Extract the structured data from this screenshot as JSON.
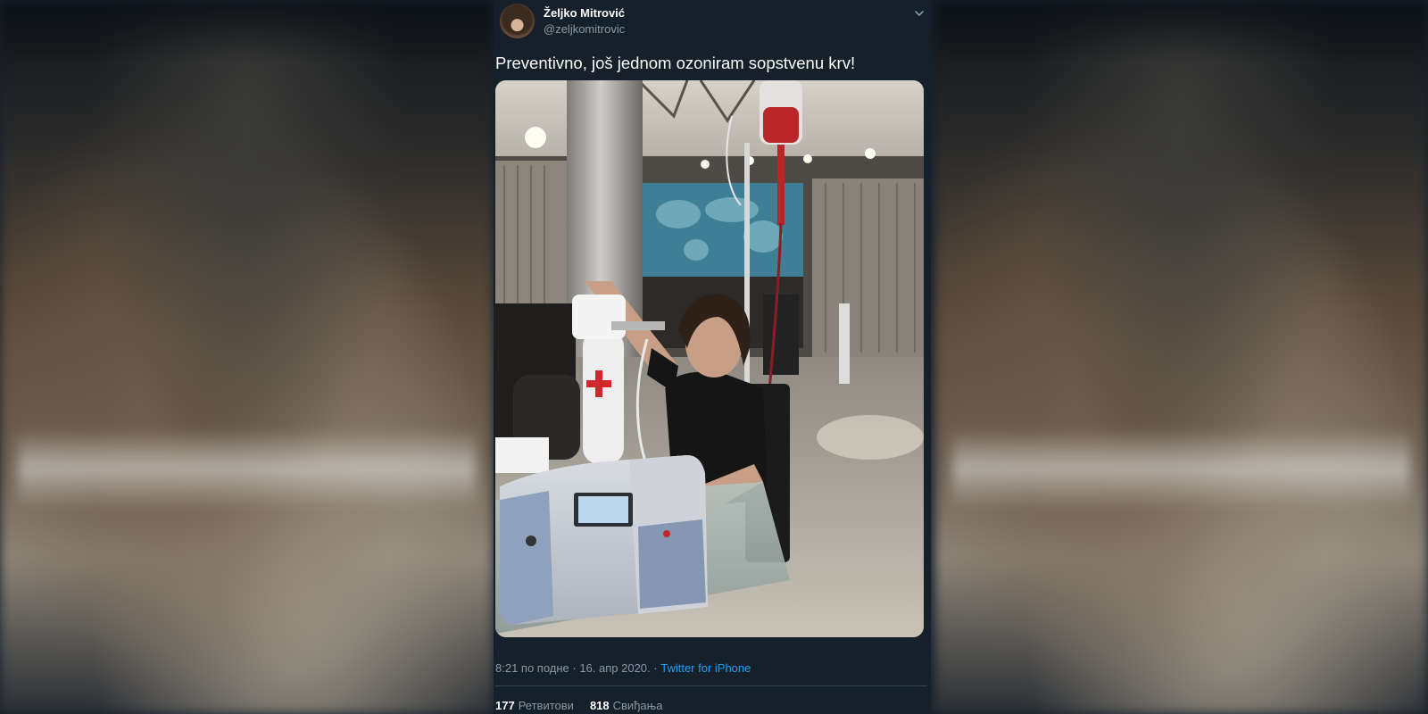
{
  "tweet": {
    "author_name": "Željko Mitrović",
    "author_handle": "@zeljkomitrovic",
    "text": "Preventivno, još jednom ozoniram sopstvenu krv!",
    "photo_alt": "photo",
    "timestamp": "8:21 по подне · 16. апр 2020. · ",
    "client": "Twitter for iPhone",
    "retweet_count": "177",
    "retweet_label": "Ретвитови",
    "like_count": "818",
    "like_label": "Свиђања"
  },
  "icons": {
    "avatar": "profile-avatar",
    "menu": "chevron-down-icon"
  },
  "colors": {
    "background": "#15202b",
    "text": "#ffffff",
    "secondary_text": "#8899a6",
    "link": "#1da1f2",
    "divider": "#38444d"
  }
}
